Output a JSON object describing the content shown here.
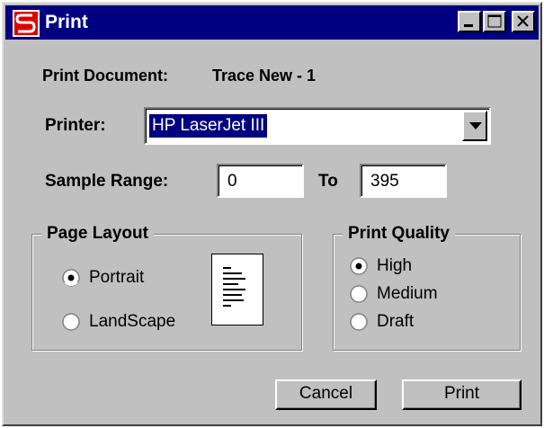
{
  "window": {
    "title": "Print",
    "app_icon": "red-s-app-icon",
    "title_buttons": [
      "minimize",
      "maximize",
      "close"
    ]
  },
  "document": {
    "label": "Print Document:",
    "name": "Trace New - 1"
  },
  "printer": {
    "label": "Printer:",
    "selected": "HP LaserJet III"
  },
  "sample_range": {
    "label": "Sample Range:",
    "from": "0",
    "to_label": "To",
    "to": "395"
  },
  "page_layout": {
    "title": "Page Layout",
    "options": [
      {
        "label": "Portrait",
        "checked": true
      },
      {
        "label": "LandScape",
        "checked": false
      }
    ],
    "preview_icon": "portrait-page-icon"
  },
  "print_quality": {
    "title": "Print Quality",
    "options": [
      {
        "label": "High",
        "checked": true
      },
      {
        "label": "Medium",
        "checked": false
      },
      {
        "label": "Draft",
        "checked": false
      }
    ]
  },
  "buttons": {
    "cancel": "Cancel",
    "print": "Print"
  },
  "colors": {
    "titlebar": "#000080",
    "face": "#c0c0c0",
    "selection": "#000080",
    "app_icon": "#e00000"
  }
}
